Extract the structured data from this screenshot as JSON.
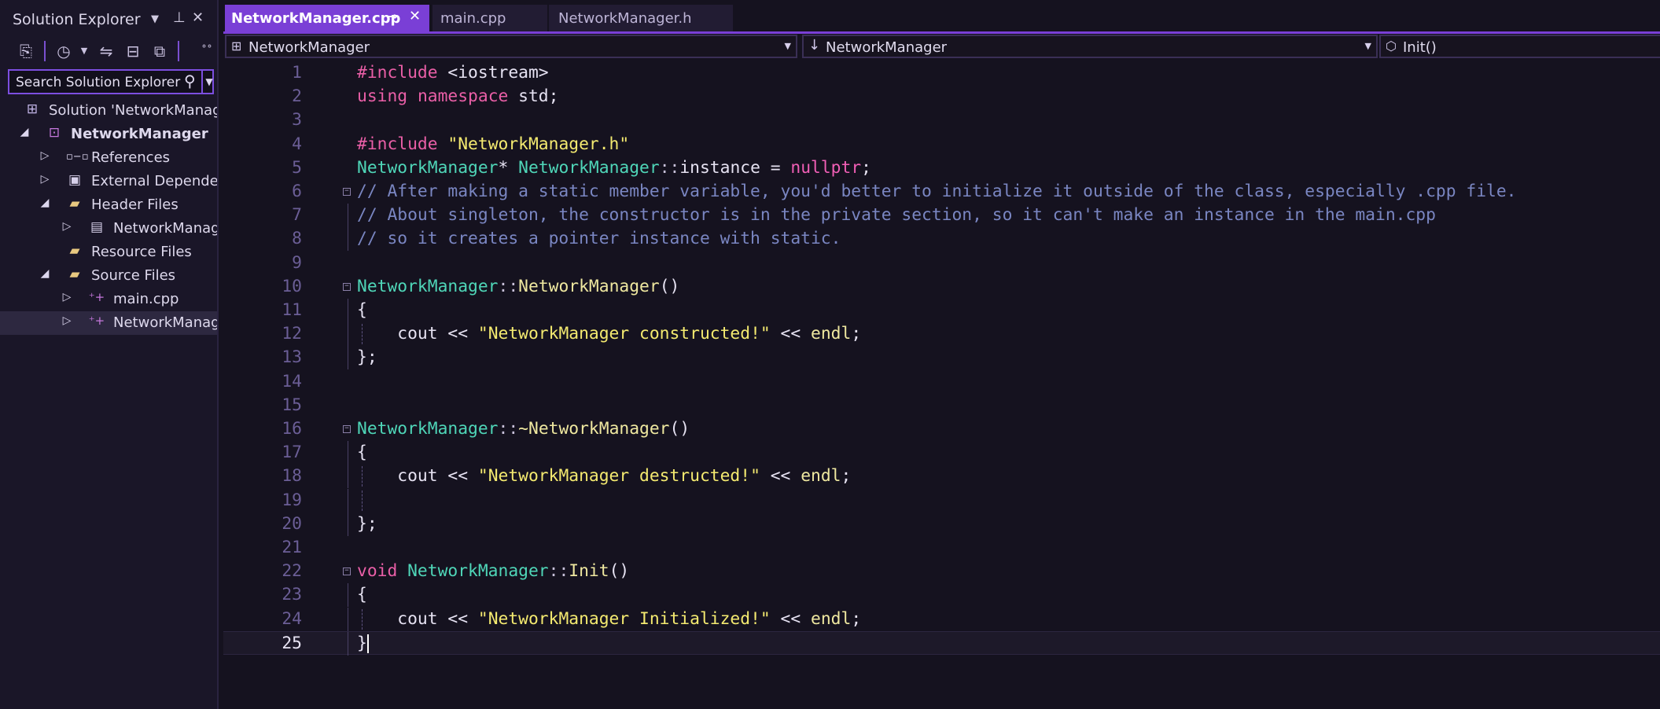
{
  "solution_explorer": {
    "title": "Solution Explorer",
    "search_placeholder": "Search Solution Explorer",
    "tree": [
      {
        "label": "Solution 'NetworkManager'",
        "icon": "solution-icon"
      },
      {
        "label": "NetworkManager",
        "icon": "project-icon",
        "bold": true
      },
      {
        "label": "References",
        "icon": "references-icon"
      },
      {
        "label": "External Dependencies",
        "icon": "external-dependencies-icon"
      },
      {
        "label": "Header Files",
        "icon": "folder-filter-icon"
      },
      {
        "label": "NetworkManager.h",
        "icon": "header-file-icon"
      },
      {
        "label": "Resource Files",
        "icon": "folder-filter-icon"
      },
      {
        "label": "Source Files",
        "icon": "folder-filter-icon"
      },
      {
        "label": "main.cpp",
        "icon": "cpp-file-icon"
      },
      {
        "label": "NetworkManager.cpp",
        "icon": "cpp-file-icon",
        "selected": true
      }
    ]
  },
  "tabs": [
    {
      "label": "NetworkManager.cpp",
      "active": true
    },
    {
      "label": "main.cpp",
      "active": false
    },
    {
      "label": "NetworkManager.h",
      "active": false
    }
  ],
  "navbar": {
    "project": "NetworkManager",
    "scope": "NetworkManager",
    "member": "Init()"
  },
  "editor": {
    "current_line": 25,
    "lines": [
      [
        [
          "#include ",
          "pp"
        ],
        [
          "<iostream>",
          "tx"
        ]
      ],
      [
        [
          "using ",
          "kw"
        ],
        [
          "namespace ",
          "kw"
        ],
        [
          "std;",
          "tx"
        ]
      ],
      [],
      [
        [
          "#include ",
          "pp"
        ],
        [
          "\"NetworkManager.h\"",
          "st"
        ]
      ],
      [
        [
          "NetworkManager",
          "ty"
        ],
        [
          "* ",
          "tx"
        ],
        [
          "NetworkManager",
          "ty"
        ],
        [
          "::",
          "op"
        ],
        [
          "instance = ",
          "tx"
        ],
        [
          "nullptr",
          "nu"
        ],
        [
          ";",
          "tx"
        ]
      ],
      [
        [
          "// After making a static member variable, you'd better to initialize it outside of the class, especially .cpp file.",
          "cm"
        ]
      ],
      [
        [
          "// About singleton, the constructor is in the private section, so it can't make an instance in the main.cpp",
          "cm"
        ]
      ],
      [
        [
          "// so it creates a pointer instance with static.",
          "cm"
        ]
      ],
      [],
      [
        [
          "NetworkManager",
          "ty"
        ],
        [
          "::",
          "op"
        ],
        [
          "NetworkManager",
          "fn"
        ],
        [
          "()",
          "tx"
        ]
      ],
      [
        [
          "{",
          "tx"
        ]
      ],
      [
        [
          "    cout << ",
          "tx"
        ],
        [
          "\"NetworkManager constructed!\"",
          "st"
        ],
        [
          " << ",
          "tx"
        ],
        [
          "endl",
          "fn"
        ],
        [
          ";",
          "tx"
        ]
      ],
      [
        [
          "};",
          "tx"
        ]
      ],
      [],
      [],
      [
        [
          "NetworkManager",
          "ty"
        ],
        [
          "::",
          "op"
        ],
        [
          "~NetworkManager",
          "fn"
        ],
        [
          "()",
          "tx"
        ]
      ],
      [
        [
          "{",
          "tx"
        ]
      ],
      [
        [
          "    cout << ",
          "tx"
        ],
        [
          "\"NetworkManager destructed!\"",
          "st"
        ],
        [
          " << ",
          "tx"
        ],
        [
          "endl",
          "fn"
        ],
        [
          ";",
          "tx"
        ]
      ],
      [],
      [
        [
          "};",
          "tx"
        ]
      ],
      [],
      [
        [
          "void ",
          "kw"
        ],
        [
          "NetworkManager",
          "ty"
        ],
        [
          "::",
          "op"
        ],
        [
          "Init",
          "fn"
        ],
        [
          "()",
          "tx"
        ]
      ],
      [
        [
          "{",
          "tx"
        ]
      ],
      [
        [
          "    cout << ",
          "tx"
        ],
        [
          "\"NetworkManager Initialized!\"",
          "st"
        ],
        [
          " << ",
          "tx"
        ],
        [
          "endl",
          "fn"
        ],
        [
          ";",
          "tx"
        ]
      ],
      [
        [
          "}",
          "tx"
        ]
      ]
    ]
  }
}
